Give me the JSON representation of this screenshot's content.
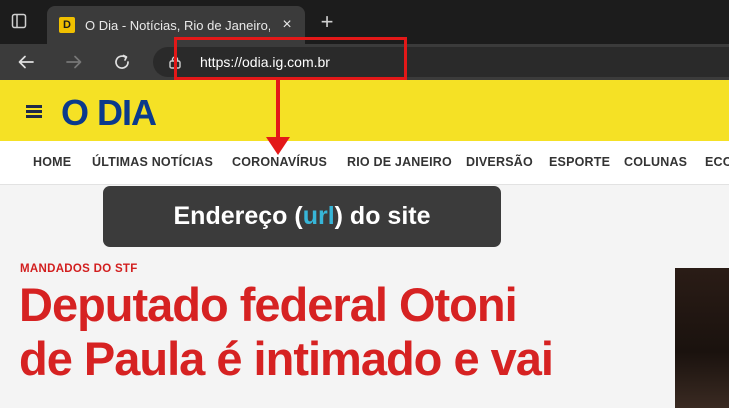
{
  "browser": {
    "tab": {
      "favicon": "D",
      "title": "O Dia - Notícias, Rio de Janeiro, ",
      "close_icon": "×"
    },
    "new_tab_icon": "+",
    "toolbar": {
      "back_icon": "arrow-left-icon",
      "forward_icon": "arrow-right-icon",
      "reload_icon": "reload-icon",
      "url": "https://odia.ig.com.br"
    }
  },
  "site": {
    "logo": "O DIA",
    "nav": [
      "HOME",
      "ÚLTIMAS NOTÍCIAS",
      "CORONAVÍRUS",
      "RIO DE JANEIRO",
      "DIVERSÃO",
      "ESPORTE",
      "COLUNAS",
      "ECO"
    ]
  },
  "annotation": {
    "prefix": "Endereço (",
    "highlight": "url",
    "suffix": ") do site",
    "color_highlight": "#37b6d8",
    "color_marker": "#e31818"
  },
  "article": {
    "kicker": "MANDADOS DO STF",
    "headline_line1": "Deputado federal Otoni",
    "headline_line2": "de Paula é intimado e vai"
  }
}
